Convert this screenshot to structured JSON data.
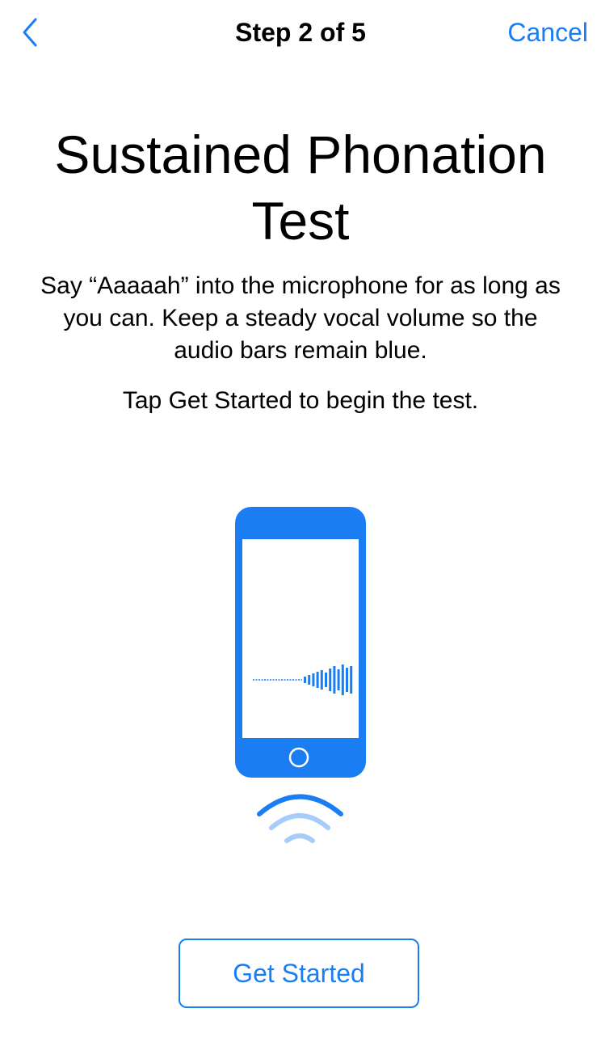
{
  "nav": {
    "back_icon": "chevron-left-icon",
    "title": "Step 2 of 5",
    "cancel_label": "Cancel"
  },
  "main": {
    "title": "Sustained Phonation Test",
    "instructions": "Say “Aaaaah” into the microphone for as long as you can. Keep a steady vocal volume so the audio bars remain blue.",
    "prompt": "Tap Get Started to begin the test."
  },
  "illustration": {
    "phone_icon": "phone-icon",
    "waveform_icon": "audio-waveform-icon",
    "sound_icon": "sound-waves-icon"
  },
  "footer": {
    "get_started_label": "Get Started"
  },
  "colors": {
    "accent": "#1a7ef2",
    "accent_light": "#a6cdf9",
    "text": "#000000",
    "background": "#ffffff"
  }
}
